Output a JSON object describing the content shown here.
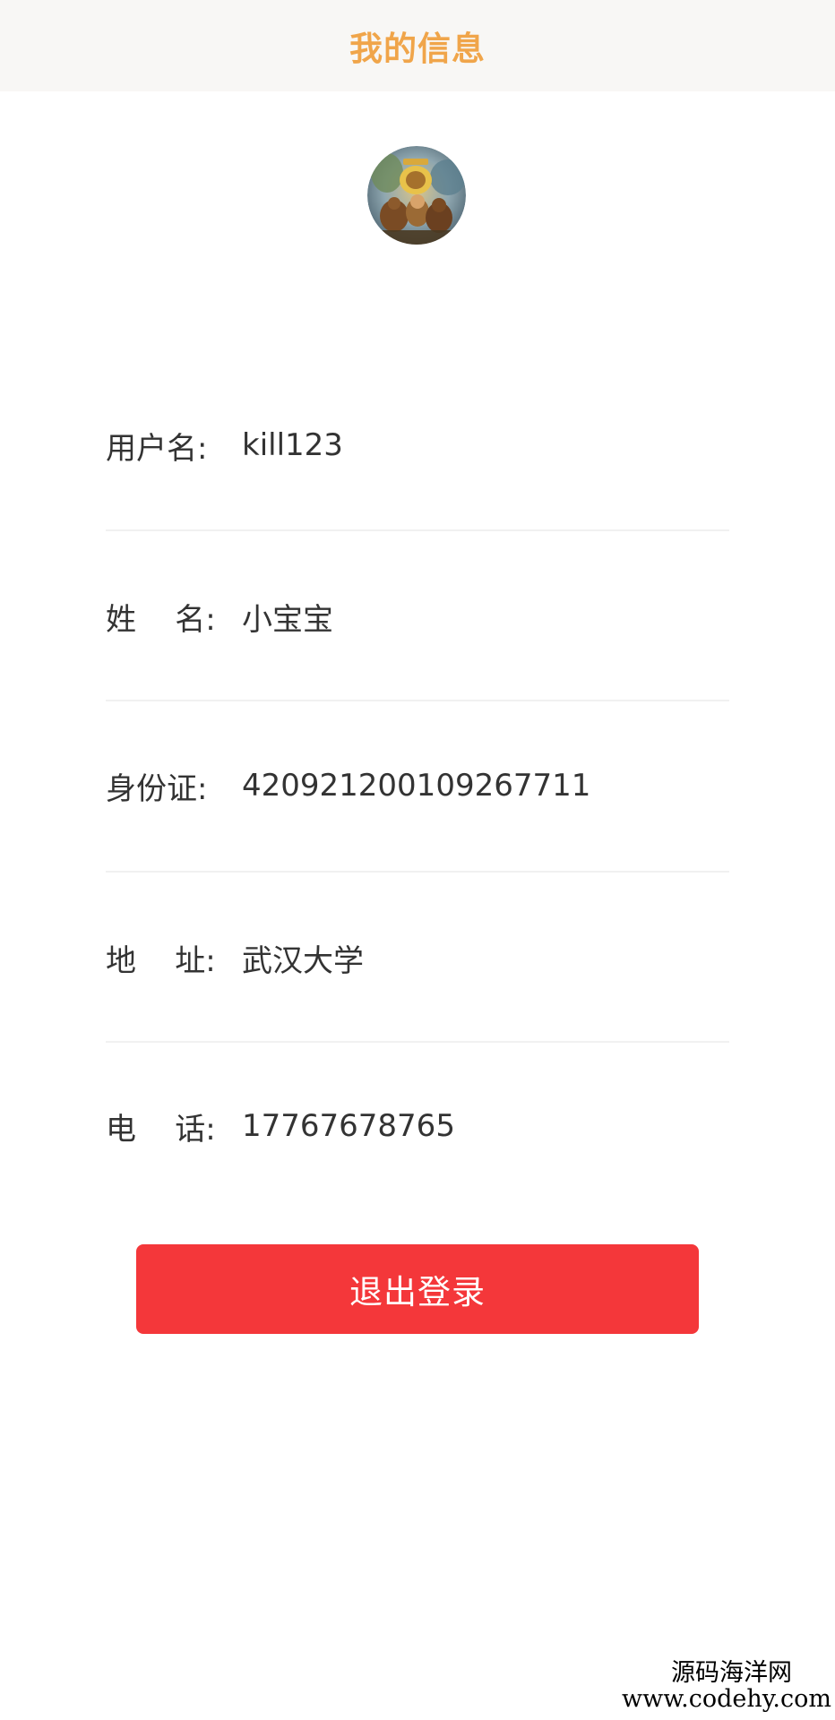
{
  "header": {
    "title": "我的信息"
  },
  "avatar": {
    "icon": "avatar-image"
  },
  "profile": {
    "rows": [
      {
        "label": "用户名:",
        "value": "kill123"
      },
      {
        "label": "姓    名:",
        "value": "小宝宝"
      },
      {
        "label": "身份证:",
        "value": "420921200109267711"
      },
      {
        "label": "地    址:",
        "value": "武汉大学"
      },
      {
        "label": "电    话:",
        "value": "17767678765"
      }
    ]
  },
  "actions": {
    "logout_label": "退出登录"
  },
  "colors": {
    "title": "#f0a54a",
    "logout_button": "#f4373a",
    "header_bg": "#f8f7f5",
    "divider": "#f1f1f1"
  },
  "watermark": {
    "site_name": "源码海洋网",
    "url": "www.codehy.com"
  }
}
